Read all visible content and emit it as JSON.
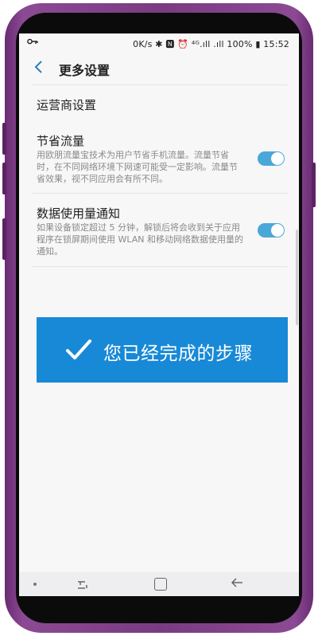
{
  "status_bar": {
    "left_icon": "key-icon",
    "right_text": "0K/s ✱ 🅽 ⏰ ⁴ᴳ.ıll .ıll 100% ▮ 15:52"
  },
  "header": {
    "back_icon": "chevron-left-icon",
    "title": "更多设置"
  },
  "settings": {
    "carrier": {
      "title": "运营商设置"
    },
    "data_saver": {
      "title": "节省流量",
      "desc": "用欧朋流量宝技术为用户节省手机流量。流量节省时，在不同网络环境下网速可能受一定影响。流量节省效果，视不同应用会有所不同。",
      "toggle_on": true
    },
    "data_usage": {
      "title": "数据使用量通知",
      "desc": "如果设备锁定超过 5 分钟，解锁后将会收到关于应用程序在锁屏期间使用 WLAN 和移动网络数据使用量的通知。",
      "toggle_on": true
    }
  },
  "banner": {
    "icon": "checkmark-icon",
    "text": "您已经完成的步骤",
    "color": "#1889d6"
  },
  "colors": {
    "accent": "#4aa8d8",
    "back_arrow": "#2a80b9",
    "frame": "#7a3b83"
  },
  "nav_bar": {
    "items": [
      "dot",
      "recent-apps-icon",
      "home-icon",
      "back-icon"
    ]
  }
}
